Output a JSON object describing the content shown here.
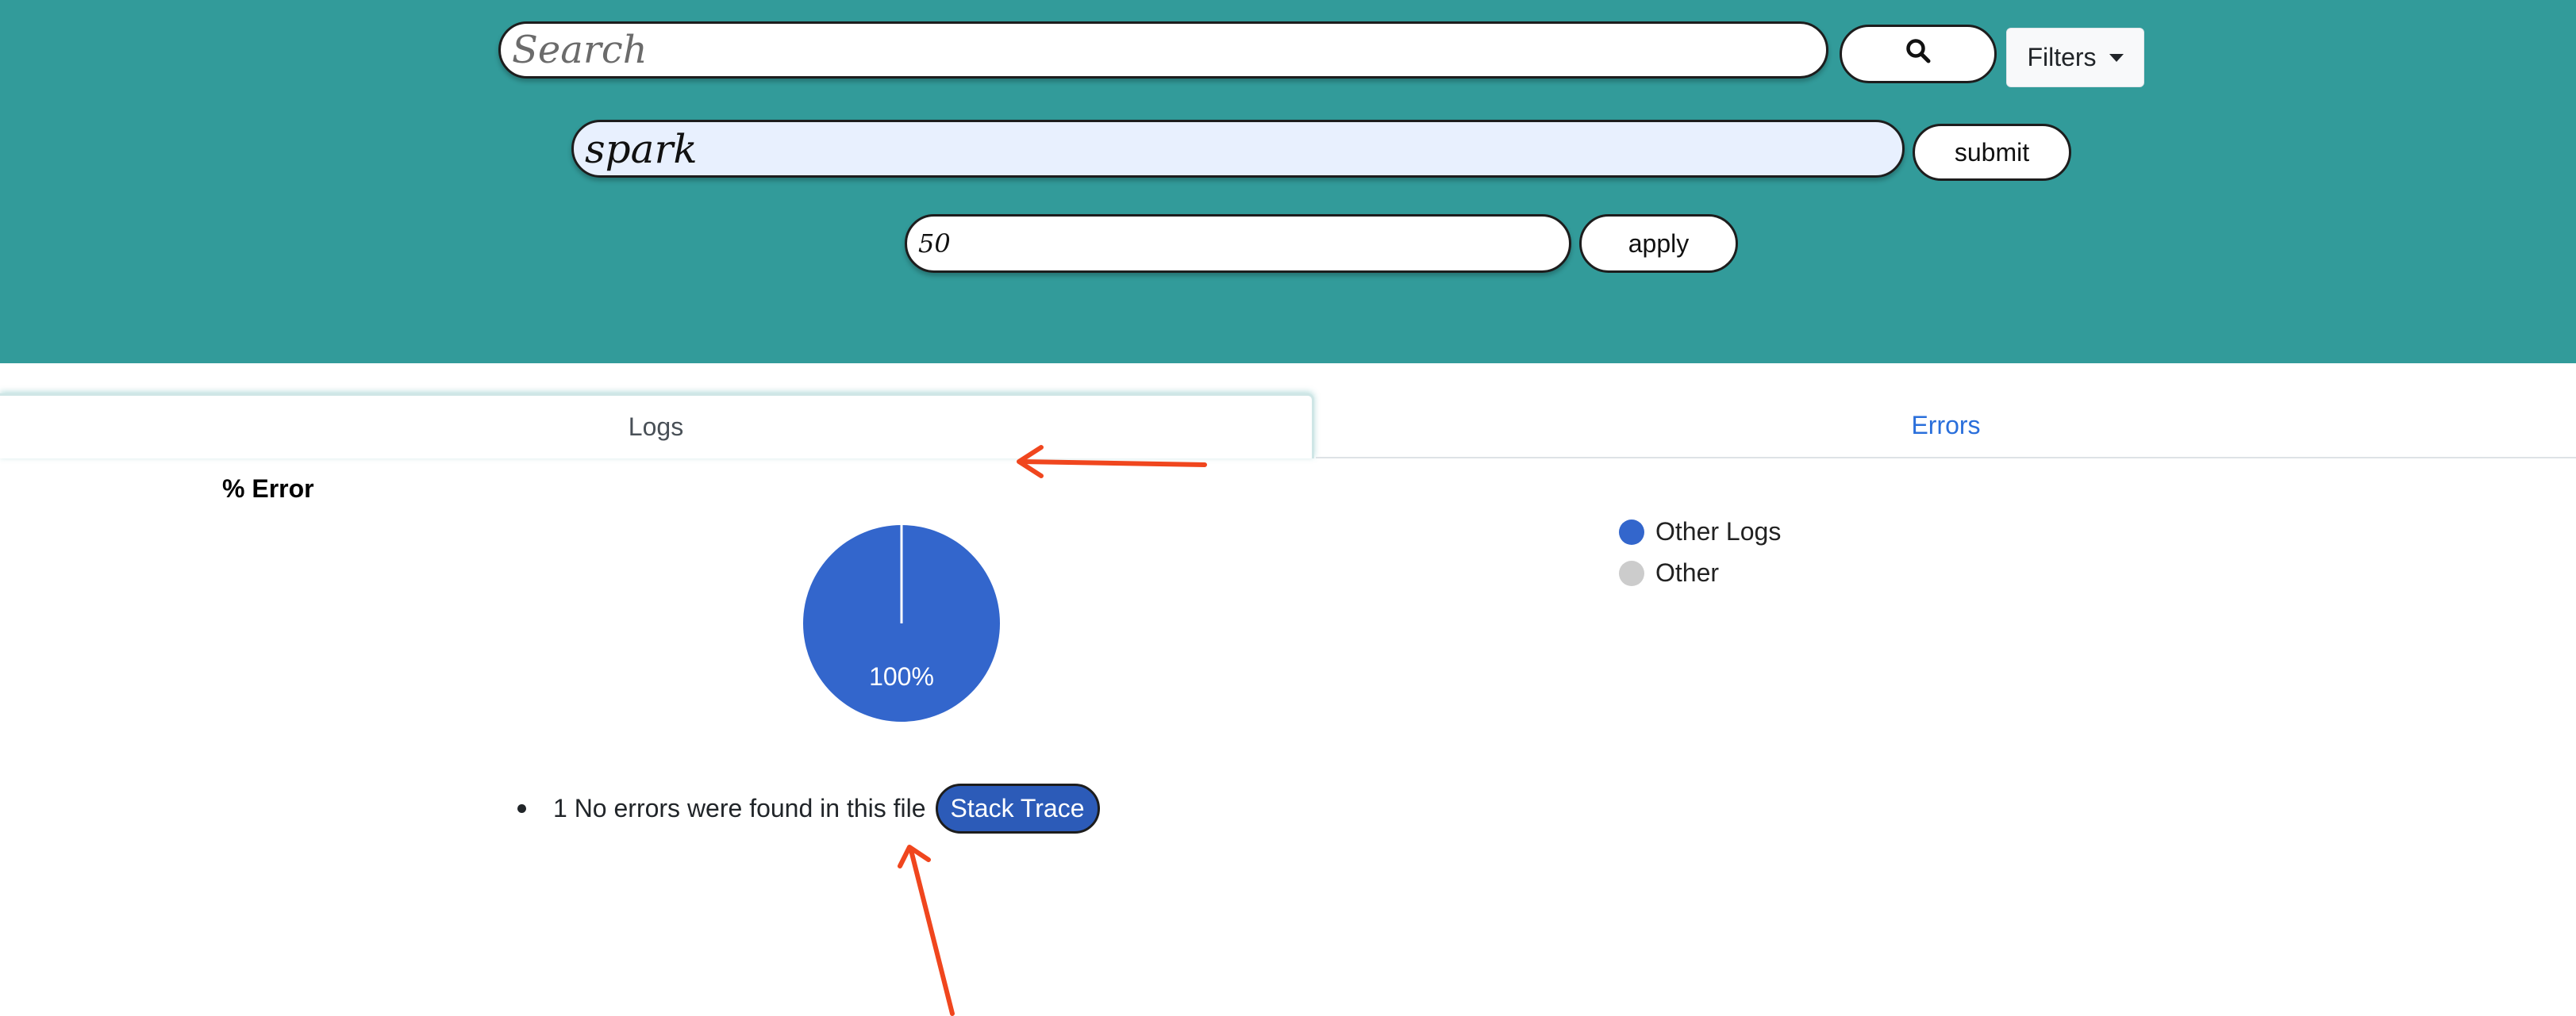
{
  "header": {
    "search": {
      "placeholder": "Search",
      "value": ""
    },
    "search_icon": "search-icon",
    "filters_label": "Filters",
    "query": {
      "value": "spark"
    },
    "submit_label": "submit",
    "limit": {
      "value": "50"
    },
    "apply_label": "apply",
    "background_color": "#329b9a"
  },
  "tabs": [
    {
      "label": "Logs",
      "active": true
    },
    {
      "label": "Errors",
      "active": false
    }
  ],
  "chart_data": {
    "type": "pie",
    "title": "% Error",
    "slices": [
      {
        "name": "Other Logs",
        "value": 100,
        "color": "#3366cc"
      },
      {
        "name": "Other",
        "value": 0,
        "color": "#cccccc"
      }
    ],
    "data_labels": [
      "100%"
    ],
    "legend_position": "right"
  },
  "errors_list": [
    {
      "text": "1 No errors were found in this file",
      "button_label": "Stack Trace"
    }
  ],
  "annotations": {
    "arrow_color": "#f0461e"
  }
}
